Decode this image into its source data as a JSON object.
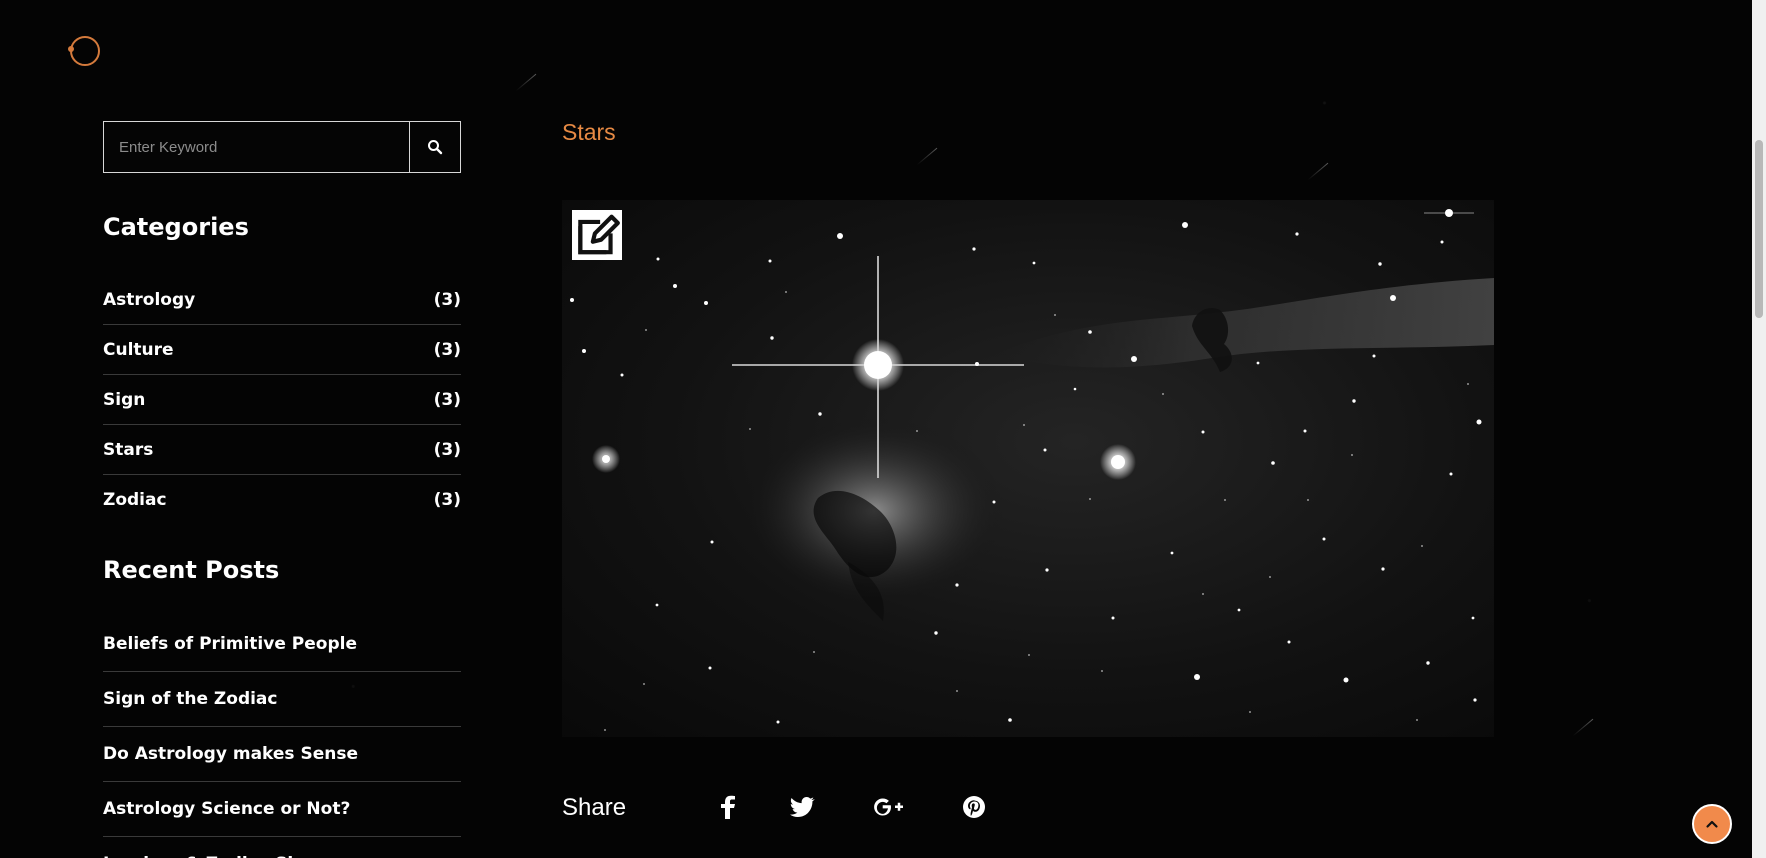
{
  "brand": {
    "logo_icon": "orbit-logo-icon",
    "accent_color": "#E78A44"
  },
  "search": {
    "placeholder": "Enter Keyword",
    "value": "",
    "button_icon": "search-icon"
  },
  "categories": {
    "title": "Categories",
    "items": [
      {
        "label": "Astrology",
        "count": "(3)"
      },
      {
        "label": "Culture",
        "count": "(3)"
      },
      {
        "label": "Sign",
        "count": "(3)"
      },
      {
        "label": "Stars",
        "count": "(3)"
      },
      {
        "label": "Zodiac",
        "count": "(3)"
      }
    ]
  },
  "recent_posts": {
    "title": "Recent Posts",
    "items": [
      {
        "label": "Beliefs of Primitive People"
      },
      {
        "label": "Sign of the Zodiac"
      },
      {
        "label": "Do Astrology makes Sense"
      },
      {
        "label": "Astrology Science or Not?"
      },
      {
        "label": "Leaders & Zodiac Signs"
      }
    ]
  },
  "post": {
    "category": "Stars",
    "image_icon": "space-nebula-image",
    "edit_icon": "edit-icon"
  },
  "share": {
    "label": "Share",
    "icons": [
      "facebook-icon",
      "twitter-icon",
      "google-plus-icon",
      "pinterest-icon"
    ]
  },
  "controls": {
    "scrollbar": "vertical-scrollbar",
    "back_to_top_icon": "chevron-up-icon"
  }
}
